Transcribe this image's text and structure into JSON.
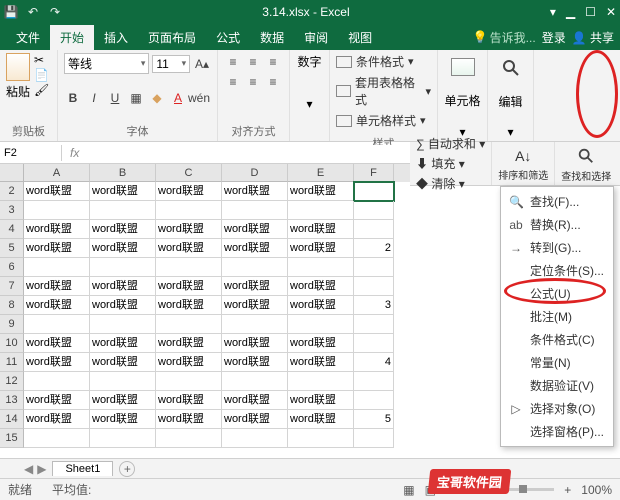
{
  "titlebar": {
    "title": "3.14.xlsx - Excel"
  },
  "menubar": {
    "tabs": [
      "文件",
      "开始",
      "插入",
      "页面布局",
      "公式",
      "数据",
      "审阅",
      "视图"
    ],
    "active": 1,
    "tell": "告诉我...",
    "login": "登录",
    "share": "共享"
  },
  "ribbon": {
    "clipboard": {
      "paste": "粘贴",
      "label": "剪贴板"
    },
    "font": {
      "name": "等线",
      "size": "11",
      "label": "字体"
    },
    "align": {
      "label": "对齐方式"
    },
    "number": {
      "btn": "数字",
      "label": ""
    },
    "styles": {
      "cond": "条件格式",
      "table": "套用表格格式",
      "cell": "单元格样式",
      "label": "样式"
    },
    "cells": {
      "label": "单元格"
    },
    "editing": {
      "label": "编辑"
    }
  },
  "subribbon": {
    "autosum": "自动求和",
    "fill": "填充",
    "clear": "清除",
    "sort": "排序和筛选",
    "find": "查找和选择"
  },
  "formula": {
    "namebox": "F2",
    "value": ""
  },
  "sheet": {
    "cols": [
      "A",
      "B",
      "C",
      "D",
      "E",
      "F"
    ],
    "rows": [
      2,
      3,
      4,
      5,
      6,
      7,
      8,
      9,
      10,
      11,
      12,
      13,
      14,
      15
    ],
    "data": {
      "2": [
        "word联盟",
        "word联盟",
        "word联盟",
        "word联盟",
        "word联盟",
        ""
      ],
      "3": [
        "",
        "",
        "",
        "",
        "",
        ""
      ],
      "4": [
        "word联盟",
        "word联盟",
        "word联盟",
        "word联盟",
        "word联盟",
        ""
      ],
      "5": [
        "word联盟",
        "word联盟",
        "word联盟",
        "word联盟",
        "word联盟",
        "2"
      ],
      "6": [
        "",
        "",
        "",
        "",
        "",
        ""
      ],
      "7": [
        "word联盟",
        "word联盟",
        "word联盟",
        "word联盟",
        "word联盟",
        ""
      ],
      "8": [
        "word联盟",
        "word联盟",
        "word联盟",
        "word联盟",
        "word联盟",
        "3"
      ],
      "9": [
        "",
        "",
        "",
        "",
        "",
        ""
      ],
      "10": [
        "word联盟",
        "word联盟",
        "word联盟",
        "word联盟",
        "word联盟",
        ""
      ],
      "11": [
        "word联盟",
        "word联盟",
        "word联盟",
        "word联盟",
        "word联盟",
        "4"
      ],
      "12": [
        "",
        "",
        "",
        "",
        "",
        ""
      ],
      "13": [
        "word联盟",
        "word联盟",
        "word联盟",
        "word联盟",
        "word联盟",
        ""
      ],
      "14": [
        "word联盟",
        "word联盟",
        "word联盟",
        "word联盟",
        "word联盟",
        "5"
      ],
      "15": [
        "",
        "",
        "",
        "",
        "",
        ""
      ]
    },
    "selected": "F2",
    "tab": "Sheet1"
  },
  "menu": [
    {
      "icon": "🔍",
      "label": "查找(F)..."
    },
    {
      "icon": "ab",
      "label": "替换(R)..."
    },
    {
      "icon": "→",
      "label": "转到(G)..."
    },
    {
      "icon": "",
      "label": "定位条件(S)..."
    },
    {
      "icon": "",
      "label": "公式(U)"
    },
    {
      "icon": "",
      "label": "批注(M)"
    },
    {
      "icon": "",
      "label": "条件格式(C)"
    },
    {
      "icon": "",
      "label": "常量(N)"
    },
    {
      "icon": "",
      "label": "数据验证(V)"
    },
    {
      "icon": "▷",
      "label": "选择对象(O)"
    },
    {
      "icon": "",
      "label": "选择窗格(P)..."
    }
  ],
  "status": {
    "ready": "就绪",
    "avg": "平均值:",
    "views": [
      "▦",
      "▣",
      "▭"
    ],
    "zoom": "100%"
  },
  "watermark": "宝哥软件园"
}
